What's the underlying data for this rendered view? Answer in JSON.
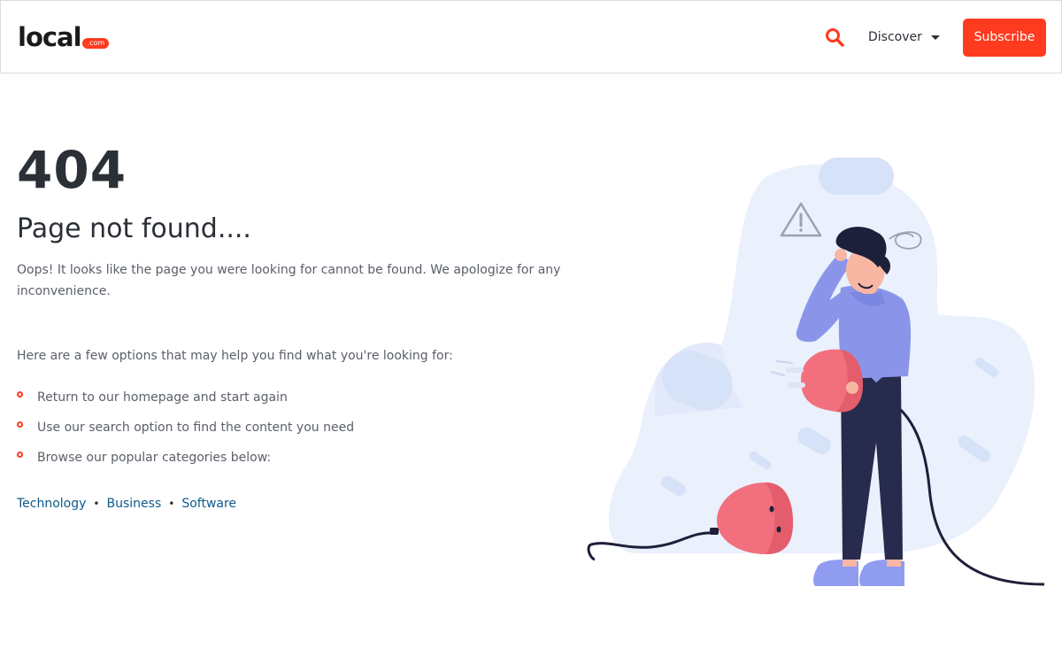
{
  "header": {
    "logo_word": "local",
    "logo_badge": ".com",
    "nav_discover": "Discover",
    "subscribe_label": "Subscribe"
  },
  "main": {
    "error_code": "404",
    "title": "Page not found....",
    "description": "Oops! It looks like the page you were looking for cannot be found. We apologize for any inconvenience.",
    "help_intro": "Here are a few options that may help you find what you're looking for:",
    "options": [
      "Return to our homepage and start again",
      "Use our search option to find the content you need",
      "Browse our popular categories below:"
    ],
    "categories": [
      "Technology",
      "Business",
      "Software"
    ],
    "separator": "•"
  },
  "colors": {
    "accent": "#ff3b1f",
    "link": "#0e5a8a",
    "text": "#2b2f36"
  },
  "icons": {
    "search": "search-icon",
    "caret": "caret-down-icon"
  }
}
